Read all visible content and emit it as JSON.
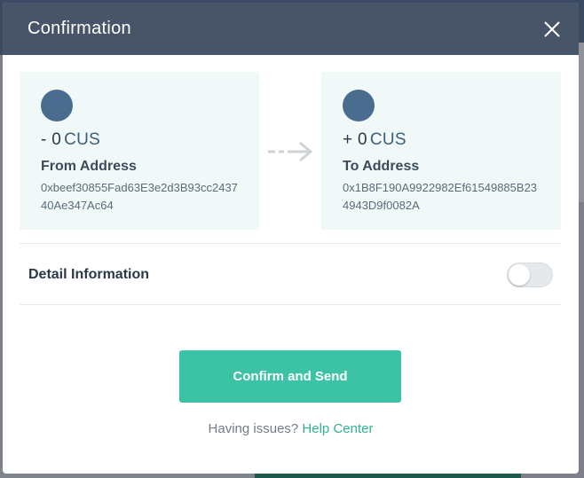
{
  "modal": {
    "title": "Confirmation",
    "close_icon": "close-icon"
  },
  "from": {
    "sign": "- ",
    "amount": "0",
    "unit": "CUS",
    "label": "From Address",
    "address": "0xbeef30855Fad63E3e2d3B93cc243740Ae347Ac64"
  },
  "to": {
    "sign": "+ ",
    "amount": "0",
    "unit": "CUS",
    "label": "To Address",
    "address": "0x1B8F190A9922982Ef61549885B234943D9f0082A"
  },
  "detail": {
    "label": "Detail Information",
    "toggle_on": false
  },
  "actions": {
    "confirm_label": "Confirm and Send",
    "help_prefix": "Having issues? ",
    "help_link": "Help Center"
  },
  "colors": {
    "header": "#485468",
    "accent": "#3cc2a5",
    "card_bg": "#f0f9f7",
    "avatar": "#4a6d8f"
  }
}
